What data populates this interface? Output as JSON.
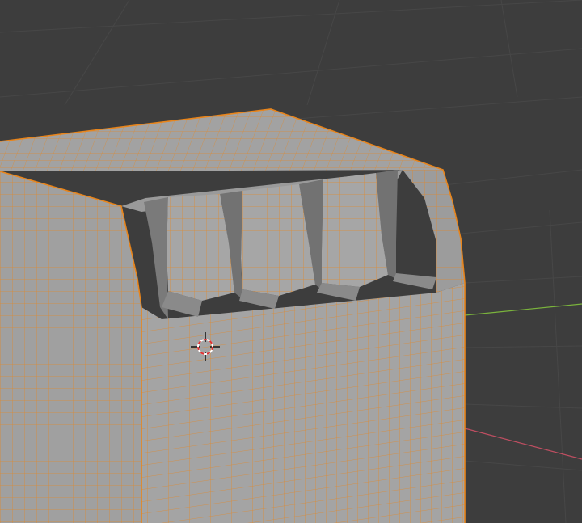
{
  "app": {
    "name": ""
  },
  "viewport": {
    "mode": "edit-mode",
    "selection": "all",
    "background_color": "#3d3d3d",
    "grid_color": "#474747",
    "axis_x_color": "#e0536b",
    "axis_y_color": "#7ab33c",
    "mesh_face_color": "#a2a2a2",
    "mesh_face_shadow": "#8a8a8a",
    "mesh_face_dark": "#727272",
    "mesh_edge_color": "#e8851c"
  },
  "cursor": {
    "icon": "3d-cursor-icon"
  }
}
